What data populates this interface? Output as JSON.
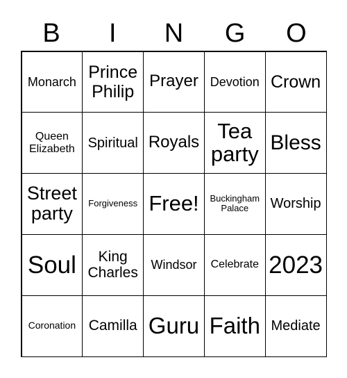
{
  "header": [
    "B",
    "I",
    "N",
    "G",
    "O"
  ],
  "cells": [
    "Monarch",
    "Prince Philip",
    "Prayer",
    "Devotion",
    "Crown",
    "Queen Elizabeth",
    "Spiritual",
    "Royals",
    "Tea party",
    "Bless",
    "Street party",
    "Forgiveness",
    "Free!",
    "Buckingham Palace",
    "Worship",
    "Soul",
    "King Charles",
    "Windsor",
    "Celebrate",
    "2023",
    "Coronation",
    "Camilla",
    "Guru",
    "Faith",
    "Mediate"
  ]
}
